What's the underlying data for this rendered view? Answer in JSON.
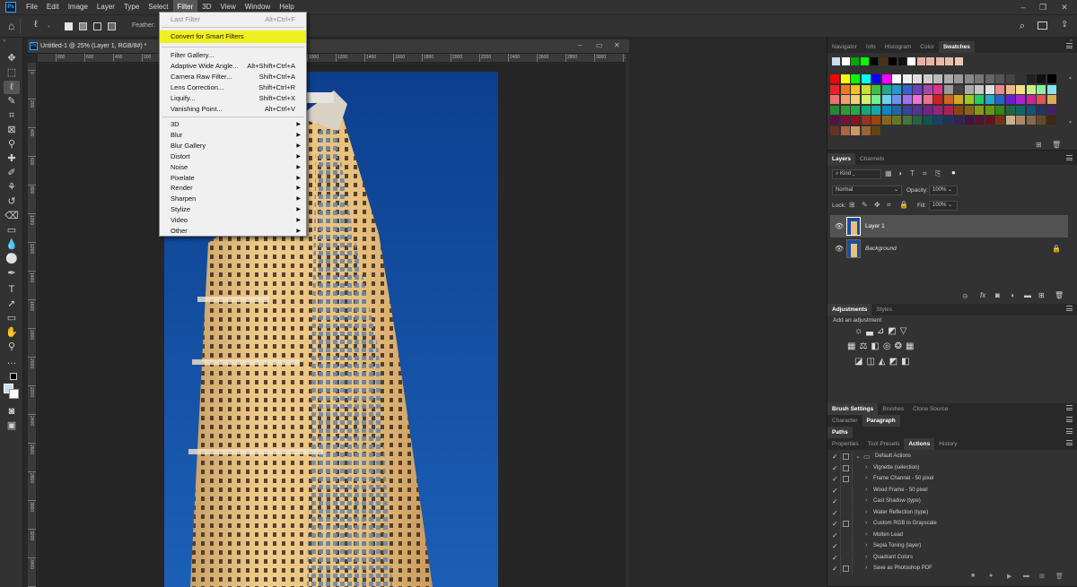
{
  "menubar": {
    "items": [
      "File",
      "Edit",
      "Image",
      "Layer",
      "Type",
      "Select",
      "Filter",
      "3D",
      "View",
      "Window",
      "Help"
    ],
    "active": "Filter"
  },
  "options": {
    "feather_label": "Feather:"
  },
  "document": {
    "title": "Untitled-1 @ 25% (Layer 1, RGB/8#) *",
    "ruler_h": [
      "800",
      "600",
      "400",
      "200",
      "1000",
      "1200",
      "1400",
      "1600",
      "1800",
      "2000",
      "2200",
      "2400",
      "2600",
      "2800",
      "3000",
      "3200"
    ],
    "ruler_v": [
      "0",
      "200",
      "400",
      "600",
      "800",
      "1000",
      "1200",
      "1400",
      "1600",
      "1800",
      "2000",
      "2200",
      "2400",
      "2600",
      "2800",
      "3000",
      "3200",
      "3400",
      "3600"
    ]
  },
  "filter_menu": {
    "last_filter": {
      "label": "Last Filter",
      "shortcut": "Alt+Ctrl+F"
    },
    "convert": "Convert for Smart Filters",
    "group1": [
      {
        "label": "Filter Gallery...",
        "shortcut": ""
      },
      {
        "label": "Adaptive Wide Angle...",
        "shortcut": "Alt+Shift+Ctrl+A"
      },
      {
        "label": "Camera Raw Filter...",
        "shortcut": "Shift+Ctrl+A"
      },
      {
        "label": "Lens Correction...",
        "shortcut": "Shift+Ctrl+R"
      },
      {
        "label": "Liquify...",
        "shortcut": "Shift+Ctrl+X"
      },
      {
        "label": "Vanishing Point...",
        "shortcut": "Alt+Ctrl+V"
      }
    ],
    "submenus": [
      "3D",
      "Blur",
      "Blur Gallery",
      "Distort",
      "Noise",
      "Pixelate",
      "Render",
      "Sharpen",
      "Stylize",
      "Video",
      "Other"
    ]
  },
  "swatches_panel": {
    "tabs": [
      "Navigator",
      "Info",
      "Histogram",
      "Color",
      "Swatches"
    ],
    "active_tab": "Swatches",
    "row0": [
      "#c8e0f0",
      "#ffffff",
      "#00aa00",
      "#00ff00",
      "#000000",
      "#4a3018",
      "#000000",
      "#111111",
      "#ffffff",
      "#e8b0a0",
      "#e8b4a4",
      "#e8b8a8",
      "#ecbcac",
      "#f0c4b4"
    ],
    "colors": [
      [
        "#ff0000",
        "#ffff00",
        "#00ff00",
        "#00ffff",
        "#0000ff",
        "#ff00ff",
        "#ffffff",
        "#eeeeee",
        "#dddddd",
        "#cccccc",
        "#bbbbbb",
        "#aaaaaa",
        "#999999",
        "#888888",
        "#777777",
        "#666666",
        "#555555",
        "#444444",
        "#333333",
        "#222222",
        "#111111",
        "#000000"
      ],
      [
        "#ee2222",
        "#f07722",
        "#f0c022",
        "#ccdd33",
        "#44bb44",
        "#22aa88",
        "#2299cc",
        "#3366cc",
        "#6644bb",
        "#aa44aa",
        "#dd3388",
        "#999999",
        "#444444",
        "#aaaaaa",
        "#c8c8c8",
        "#e0e0e0",
        "#f08888",
        "#f0b888",
        "#f0e088",
        "#c8f088",
        "#88f0a0",
        "#88e0f0"
      ],
      [
        "#f07070",
        "#f0a070",
        "#f0d070",
        "#d0f070",
        "#70f090",
        "#70d0f0",
        "#7090f0",
        "#a070f0",
        "#f070d0",
        "#f07090",
        "#cc2222",
        "#cc6622",
        "#ccaa22",
        "#99cc22",
        "#22cc66",
        "#22aacc",
        "#2266cc",
        "#6622cc",
        "#aa22cc",
        "#cc2299",
        "#dd5555",
        "#ddaa55"
      ],
      [
        "#228833",
        "#339933",
        "#22aa44",
        "#11aa77",
        "#11aaaa",
        "#1188bb",
        "#2266aa",
        "#334499",
        "#553399",
        "#772288",
        "#992277",
        "#aa2255",
        "#884411",
        "#886611",
        "#889911",
        "#669911",
        "#338811",
        "#226644",
        "#116666",
        "#115577",
        "#223366",
        "#442266"
      ],
      [
        "#551144",
        "#771133",
        "#881122",
        "#993322",
        "#994411",
        "#886622",
        "#667722",
        "#447733",
        "#226644",
        "#115555",
        "#114466",
        "#223355",
        "#332255",
        "#441144",
        "#551133",
        "#661122",
        "#773311",
        "#c8b090",
        "#a88868",
        "#886848",
        "#664828",
        "#442810"
      ],
      [
        "#663322",
        "#aa6644",
        "#cc9966",
        "#996633",
        "#664411"
      ]
    ]
  },
  "layers_panel": {
    "tabs": [
      "Layers",
      "Channels"
    ],
    "active_tab": "Layers",
    "kind": "Kind",
    "blend": "Normal",
    "opacity_label": "Opacity:",
    "opacity": "100%",
    "lock_label": "Lock:",
    "fill_label": "Fill:",
    "fill": "100%",
    "layers": [
      "Layer 1",
      "Background"
    ]
  },
  "adjustments_panel": {
    "tabs": [
      "Adjustments",
      "Styles"
    ],
    "active_tab": "Adjustments",
    "hint": "Add an adjustment"
  },
  "brush_panel": {
    "tabs": [
      "Brush Settings",
      "Brushes",
      "Clone Source"
    ],
    "active_tab": "Brush Settings"
  },
  "char_panel": {
    "tabs": [
      "Character",
      "Paragraph"
    ],
    "active_tab": "Paragraph"
  },
  "paths_panel": {
    "tabs": [
      "Paths"
    ],
    "active_tab": "Paths"
  },
  "actions_panel": {
    "tabs": [
      "Properties",
      "Tool Presets",
      "Actions",
      "History"
    ],
    "active_tab": "Actions",
    "set_name": "Default Actions",
    "actions": [
      {
        "label": "Vignette (selection)",
        "dialog": true
      },
      {
        "label": "Frame Channel - 50 pixel",
        "dialog": true
      },
      {
        "label": "Wood Frame - 50 pixel",
        "dialog": false
      },
      {
        "label": "Cast Shadow (type)",
        "dialog": false
      },
      {
        "label": "Water Reflection (type)",
        "dialog": false
      },
      {
        "label": "Custom RGB to Grayscale",
        "dialog": true
      },
      {
        "label": "Molten Lead",
        "dialog": false
      },
      {
        "label": "Sepia Toning (layer)",
        "dialog": false
      },
      {
        "label": "Quadrant Colors",
        "dialog": false
      },
      {
        "label": "Save as Photoshop PDF",
        "dialog": true
      }
    ]
  }
}
